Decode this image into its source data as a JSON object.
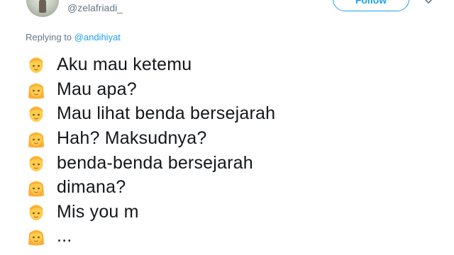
{
  "author": {
    "handle": "@zelafriadi_"
  },
  "follow_label": "Follow",
  "reply": {
    "prefix": "Replying to",
    "mention": "@andihiyat"
  },
  "lines": [
    {
      "emoji": "boy-face-icon",
      "text": "Aku mau ketemu"
    },
    {
      "emoji": "girl-face-icon",
      "text": "Mau apa?"
    },
    {
      "emoji": "boy-face-icon",
      "text": "Mau lihat benda bersejarah"
    },
    {
      "emoji": "girl-face-icon",
      "text": "Hah? Maksudnya?"
    },
    {
      "emoji": "boy-face-icon",
      "text": "benda-benda bersejarah"
    },
    {
      "emoji": "girl-face-icon",
      "text": "dimana?"
    },
    {
      "emoji": "boy-face-icon",
      "text": "Mis you m"
    },
    {
      "emoji": "girl-face-icon",
      "text": "..."
    }
  ],
  "colors": {
    "accent": "#1da1f2",
    "muted": "#657786",
    "text": "#14171a",
    "emoji_face": "#ffcc4d",
    "emoji_hair": "#ffac33"
  }
}
